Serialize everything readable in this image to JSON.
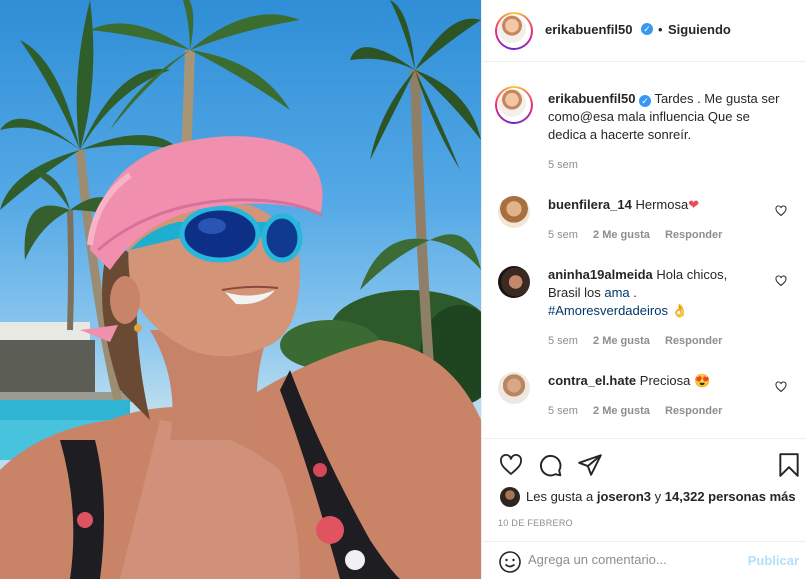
{
  "header": {
    "username": "erikabuenfil50",
    "separator": "•",
    "follow_status": "Siguiendo"
  },
  "caption": {
    "username": "erikabuenfil50",
    "text": "Tardes . Me gusta ser como@esa mala influencia Que se dedica a hacerte sonreír.",
    "time": "5 sem"
  },
  "comments": [
    {
      "username": "buenfilera_14",
      "text": "Hermosa",
      "emoji": "❤",
      "time": "5 sem",
      "likes": "2 Me gusta",
      "reply": "Responder"
    },
    {
      "username": "aninha19almeida",
      "text_1": "Hola chicos,",
      "text_2": "Brasil los",
      "link_1": "ama",
      "text_3": ".",
      "hashtag": "#Amoresverdadeiros",
      "emoji": "👌",
      "time": "5 sem",
      "likes": "2 Me gusta",
      "reply": "Responder"
    },
    {
      "username": "contra_el.hate",
      "text": "Preciosa",
      "emoji": "😍",
      "time": "5 sem",
      "likes": "2 Me gusta",
      "reply": "Responder"
    }
  ],
  "likes": {
    "prefix": "Les gusta a",
    "user": "joseron3",
    "middle": "y",
    "count": "14,322 personas más"
  },
  "date": "10 DE FEBRERO",
  "add_comment": {
    "placeholder": "Agrega un comentario...",
    "publish_label": "Publicar"
  },
  "colors": {
    "verified": "#3897f0",
    "heart_red": "#ed4956",
    "link": "#00376b",
    "publish_disabled": "#b2dffc"
  },
  "icons": [
    "verified-badge-icon",
    "heart-icon",
    "comment-icon",
    "share-icon",
    "bookmark-icon",
    "emoji-icon"
  ]
}
